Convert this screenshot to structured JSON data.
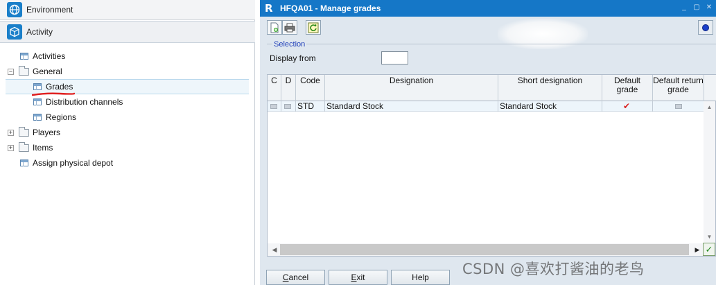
{
  "left_nav": {
    "environment_label": "Environment",
    "activity_label": "Activity",
    "tree": [
      {
        "label": "Activities",
        "type": "item",
        "level": 1
      },
      {
        "label": "General",
        "type": "folder",
        "expander": "−",
        "level": 0
      },
      {
        "label": "Grades",
        "type": "item",
        "level": 2,
        "selected": true
      },
      {
        "label": "Distribution channels",
        "type": "item",
        "level": 2
      },
      {
        "label": "Regions",
        "type": "item",
        "level": 2
      },
      {
        "label": "Players",
        "type": "folder",
        "expander": "+",
        "level": 0
      },
      {
        "label": "Items",
        "type": "folder",
        "expander": "+",
        "level": 0
      },
      {
        "label": "Assign physical depot",
        "type": "item",
        "level": 1
      }
    ]
  },
  "window": {
    "logo": "R",
    "title": "HFQA01 - Manage grades",
    "controls": [
      "_",
      "▢",
      "✕"
    ],
    "toolbar_icons": [
      "new-icon",
      "print-icon",
      "refresh-icon"
    ],
    "help_icon": "help-icon"
  },
  "selection": {
    "legend": "Selection",
    "display_from_label": "Display from",
    "display_from_value": ""
  },
  "grid": {
    "columns": [
      "C",
      "D",
      "Code",
      "Designation",
      "Short designation",
      "Default grade",
      "Default return grade"
    ],
    "rows": [
      {
        "c": false,
        "d": false,
        "code": "STD",
        "designation": "Standard Stock",
        "short_designation": "Standard Stock",
        "default_grade": true,
        "default_return_grade": false
      }
    ]
  },
  "buttons": {
    "cancel": {
      "first": "C",
      "rest": "ancel"
    },
    "exit": {
      "first": "E",
      "rest": "xit"
    },
    "help": "Help"
  },
  "watermark": "CSDN @喜欢打酱油的老鸟",
  "colors": {
    "titlebar": "#1577c7",
    "accent": "#1a7fc9",
    "selection_legend": "#1f3fb8",
    "check_red": "#d81d1d",
    "ok_green": "#238a20"
  }
}
